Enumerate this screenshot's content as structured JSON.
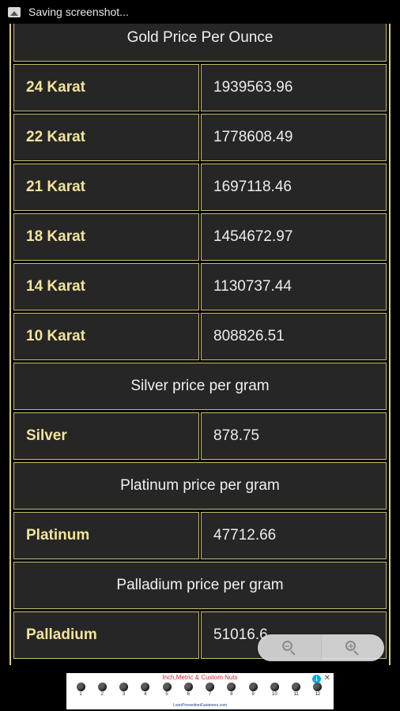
{
  "status_bar": {
    "text": "Saving screenshot..."
  },
  "table": {
    "gold_header": "Gold Price Per Ounce",
    "gold_rows": [
      {
        "label": "24 Karat",
        "value": "1939563.96"
      },
      {
        "label": "22 Karat",
        "value": "1778608.49"
      },
      {
        "label": "21 Karat",
        "value": "1697118.46"
      },
      {
        "label": "18 Karat",
        "value": "1454672.97"
      },
      {
        "label": "14 Karat",
        "value": "1130737.44"
      },
      {
        "label": "10 Karat",
        "value": "808826.51"
      }
    ],
    "silver_header": "Silver price per gram",
    "silver_row": {
      "label": "Silver",
      "value": "878.75"
    },
    "platinum_header": "Platinum price per gram",
    "platinum_row": {
      "label": "Platinum",
      "value": "47712.66"
    },
    "palladium_header": "Palladium price per gram",
    "palladium_row": {
      "label": "Palladium",
      "value": "51016.6"
    }
  },
  "zoom": {
    "out_icon": "zoom-out-icon",
    "in_icon": "zoom-in-icon"
  },
  "ad": {
    "headline": "Inch,Metric & Custom Nuts",
    "item_numbers": [
      "1",
      "2",
      "3",
      "4",
      "5",
      "6",
      "7",
      "8",
      "9",
      "10",
      "11",
      "12"
    ],
    "footer": "LoonPreventionFasteners.com",
    "info_icon": "info-icon",
    "close_icon": "close-icon"
  }
}
